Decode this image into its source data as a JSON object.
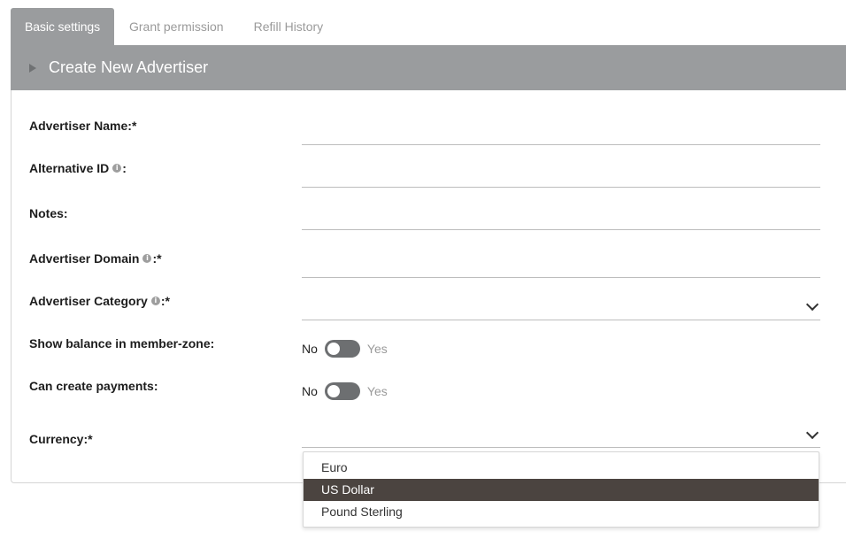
{
  "tabs": [
    {
      "label": "Basic settings"
    },
    {
      "label": "Grant permission"
    },
    {
      "label": "Refill History"
    }
  ],
  "panel": {
    "title": "Create New Advertiser"
  },
  "form": {
    "advertiser_name_label": "Advertiser Name:",
    "alternative_id_label": "Alternative ID",
    "notes_label": "Notes:",
    "advertiser_domain_label": "Advertiser Domain",
    "advertiser_category_label": "Advertiser Category",
    "show_balance_label": "Show balance in member-zone:",
    "can_create_payments_label": "Can create payments:",
    "currency_label": "Currency:",
    "required_mark": "*",
    "colon": ":",
    "info_glyph": "i",
    "toggle_no": "No",
    "toggle_yes": "Yes"
  },
  "currency_options": [
    {
      "label": "Euro",
      "selected": false
    },
    {
      "label": "US Dollar",
      "selected": true
    },
    {
      "label": "Pound Sterling",
      "selected": false
    }
  ],
  "icons": {
    "collapse": "caret-right-icon",
    "info": "info-icon",
    "select": "chevron-down-icon"
  },
  "colors": {
    "header_bg": "#9a9c9e",
    "toggle_off": "#6d6f71",
    "selected_option_bg": "#4b4440"
  }
}
